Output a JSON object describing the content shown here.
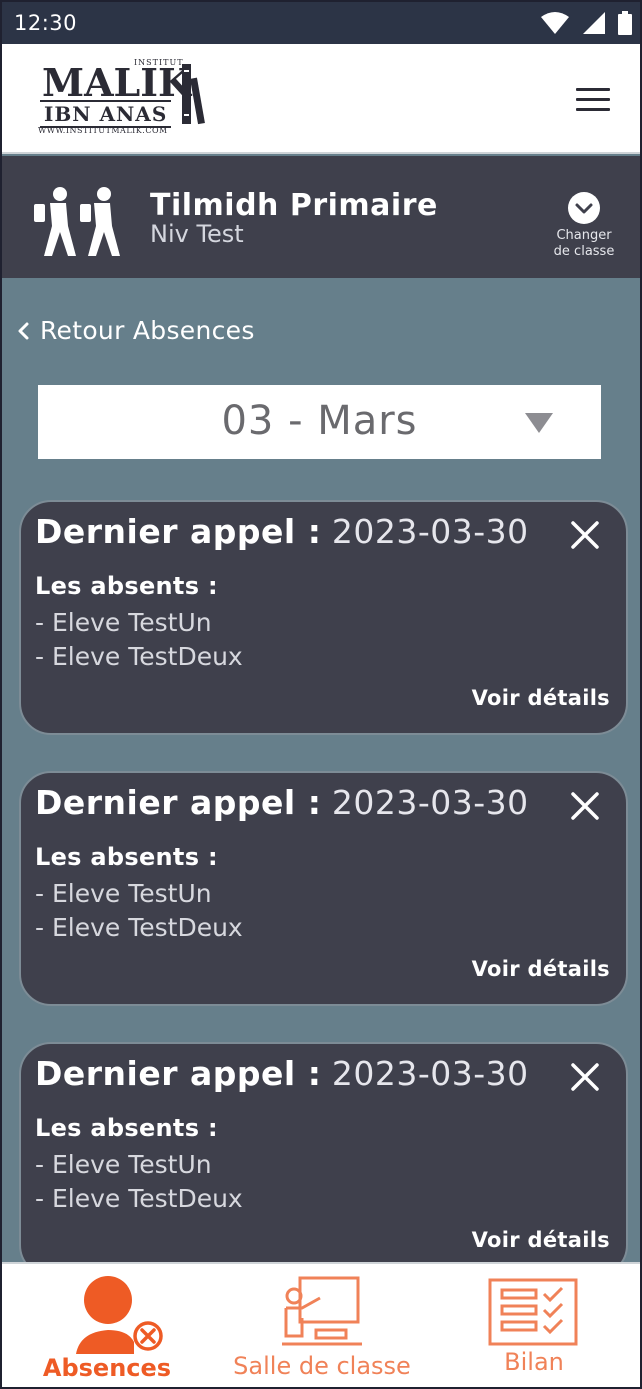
{
  "status_bar": {
    "time": "12:30",
    "icons": [
      "wifi-icon",
      "signal-icon",
      "battery-icon"
    ]
  },
  "logo": {
    "top": "MALIK",
    "small": "INSTITUT",
    "middle": "IBN ANAS",
    "site": "WWW.INSTITUTMALIK.COM"
  },
  "class_bar": {
    "title": "Tilmidh Primaire",
    "subtitle": "Niv Test",
    "change_line1": "Changer",
    "change_line2": "de classe"
  },
  "back_link": {
    "label": "Retour Absences"
  },
  "month_select": {
    "value": "03 - Mars"
  },
  "cards": [
    {
      "label": "Dernier appel :",
      "date": "2023-03-30",
      "absent_title": "Les absents :",
      "students": [
        "- Eleve TestUn",
        "- Eleve TestDeux"
      ],
      "details": "Voir détails"
    },
    {
      "label": "Dernier appel :",
      "date": "2023-03-30",
      "absent_title": "Les absents :",
      "students": [
        "- Eleve TestUn",
        "- Eleve TestDeux"
      ],
      "details": "Voir détails"
    },
    {
      "label": "Dernier appel :",
      "date": "2023-03-30",
      "absent_title": "Les absents :",
      "students": [
        "- Eleve TestUn",
        "- Eleve TestDeux"
      ],
      "details": "Voir détails"
    }
  ],
  "bottom_nav": [
    {
      "label": "Absences",
      "icon": "person-absent-icon",
      "active": true
    },
    {
      "label": "Salle de classe",
      "icon": "classroom-teacher-icon",
      "active": false
    },
    {
      "label": "Bilan",
      "icon": "report-checklist-icon",
      "active": false
    }
  ],
  "colors": {
    "accent": "#ee5b25",
    "card_bg": "#3f404c",
    "page_bg": "#667f8b",
    "status_bar": "#2c3446"
  }
}
